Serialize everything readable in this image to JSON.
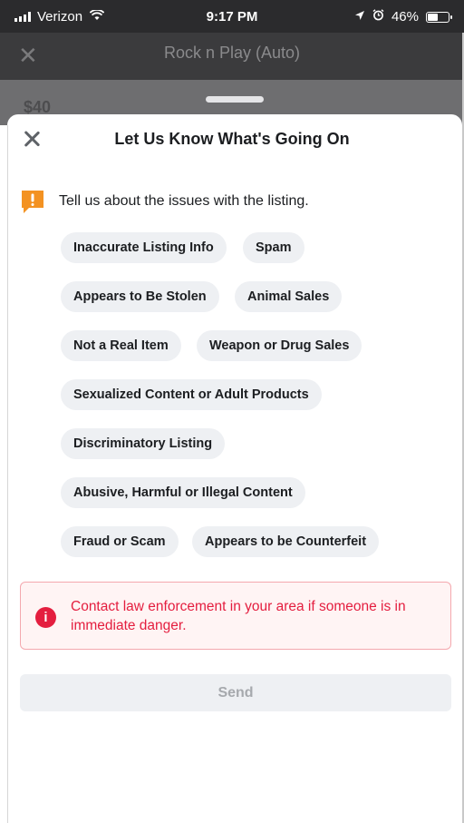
{
  "status_bar": {
    "carrier": "Verizon",
    "time": "9:17 PM",
    "battery": "46%",
    "battery_level": 0.46
  },
  "background_page": {
    "title": "Rock n Play (Auto)",
    "price": "$40"
  },
  "sheet": {
    "title": "Let Us Know What's Going On",
    "prompt": "Tell us about the issues with the listing."
  },
  "issues": [
    "Inaccurate Listing Info",
    "Spam",
    "Appears to Be Stolen",
    "Animal Sales",
    "Not a Real Item",
    "Weapon or Drug Sales",
    "Sexualized Content or Adult Products",
    "Discriminatory Listing",
    "Abusive, Harmful or Illegal Content",
    "Fraud or Scam",
    "Appears to be Counterfeit"
  ],
  "alert": {
    "message": "Contact law enforcement in your area if someone is in immediate danger."
  },
  "send_label": "Send",
  "colors": {
    "accent_red": "#e41e3f",
    "flag_orange": "#f39222",
    "chip_bg": "#eef0f3"
  }
}
